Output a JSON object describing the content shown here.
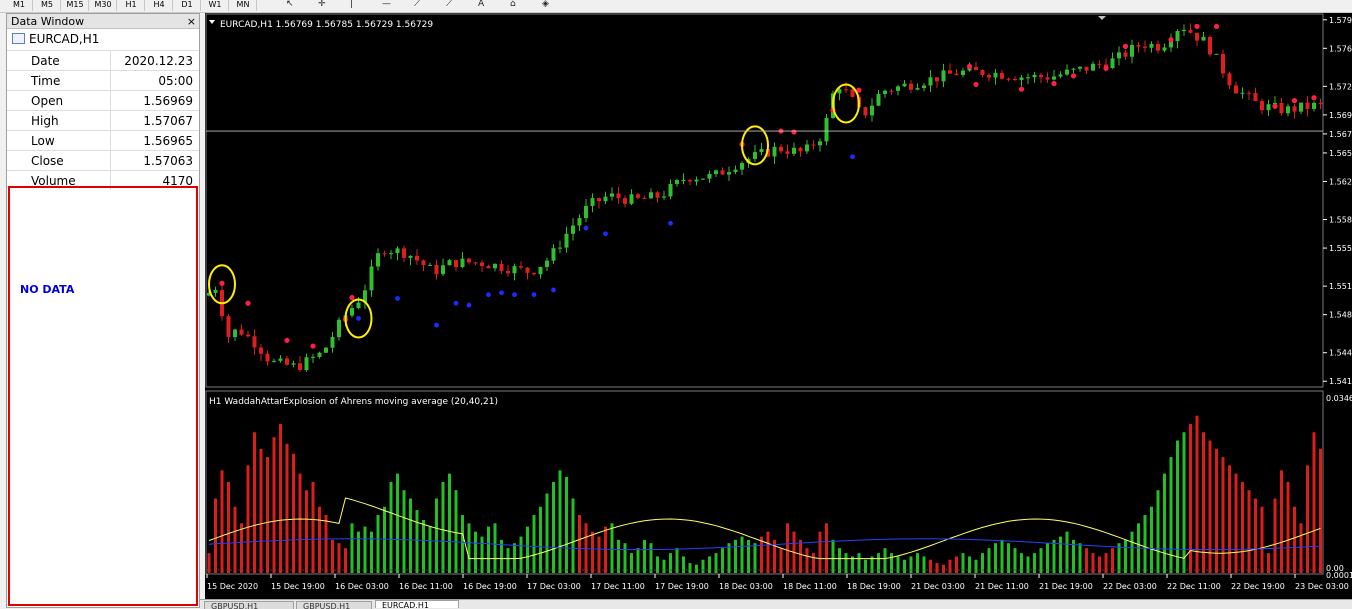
{
  "toolbar": {
    "timeframes": [
      "M1",
      "M5",
      "M15",
      "M30",
      "H1",
      "H4",
      "D1",
      "W1",
      "MN"
    ],
    "tool_icons": [
      "cursor-icon",
      "crosshair-icon",
      "vertical-line-icon",
      "horizontal-line-icon",
      "fibonacci-icon",
      "fibonacci-fan-icon",
      "text-icon",
      "label-icon",
      "shapes-dropdown-icon"
    ]
  },
  "data_window": {
    "title": "Data Window",
    "close": "×",
    "symbol": "EURCAD,H1",
    "rows": [
      {
        "label": "Date",
        "value": "2020.12.23"
      },
      {
        "label": "Time",
        "value": "05:00"
      },
      {
        "label": "Open",
        "value": "1.56969"
      },
      {
        "label": "High",
        "value": "1.57067"
      },
      {
        "label": "Low",
        "value": "1.56965"
      },
      {
        "label": "Close",
        "value": "1.57063"
      },
      {
        "label": "Volume",
        "value": "4170"
      }
    ],
    "empty_text": "NO DATA"
  },
  "chart_data": [
    {
      "type": "candlestick",
      "header": "EURCAD,H1  1.56769 1.56785 1.56729 1.56729",
      "current_price": 1.5673,
      "y_ticks": [
        "1.579",
        "1.576",
        "1.572",
        "1.569",
        "1.567",
        "1.565",
        "1.562",
        "1.558",
        "1.555",
        "1.551",
        "1.548",
        "1.544",
        "1.541"
      ],
      "ylim": [
        1.5405,
        1.5795
      ],
      "bull_color": "#2fbf2f",
      "bear_color": "#e01e1e",
      "markers_red": [
        [
          2,
          1.5513
        ],
        [
          6,
          1.5492
        ],
        [
          12,
          1.5453
        ],
        [
          16,
          1.5447
        ],
        [
          21,
          1.5475
        ],
        [
          22,
          1.5498
        ],
        [
          82,
          1.5659
        ],
        [
          88,
          1.5673
        ],
        [
          90,
          1.5672
        ],
        [
          96,
          1.5695
        ],
        [
          100,
          1.5716
        ],
        [
          117,
          1.5741
        ],
        [
          118,
          1.5722
        ],
        [
          125,
          1.5717
        ],
        [
          130,
          1.5723
        ],
        [
          133,
          1.5731
        ],
        [
          138,
          1.5739
        ],
        [
          141,
          1.5762
        ],
        [
          148,
          1.5769
        ],
        [
          152,
          1.5783
        ],
        [
          155,
          1.5783
        ],
        [
          164,
          1.5699
        ],
        [
          167,
          1.5705
        ],
        [
          170,
          1.5708
        ]
      ],
      "markers_blue": [
        [
          23,
          1.5476
        ],
        [
          29,
          1.5497
        ],
        [
          35,
          1.5469
        ],
        [
          38,
          1.5492
        ],
        [
          40,
          1.549
        ],
        [
          43,
          1.5501
        ],
        [
          45,
          1.5503
        ],
        [
          47,
          1.5501
        ],
        [
          50,
          1.5501
        ],
        [
          53,
          1.5506
        ],
        [
          58,
          1.5571
        ],
        [
          61,
          1.5565
        ],
        [
          71,
          1.5576
        ],
        [
          99,
          1.5646
        ]
      ],
      "circles": [
        [
          2,
          1.5512
        ],
        [
          23,
          1.5476
        ],
        [
          84,
          1.5658
        ],
        [
          98,
          1.5702
        ]
      ]
    },
    {
      "type": "bar",
      "title": "H1 WaddahAttarExplosion of Ahrens moving average (20,40,21)",
      "y_ticks": [
        "0.0346",
        "0.00",
        "0.0001"
      ],
      "x_ticks": [
        "15 Dec 2020",
        "15 Dec 19:00",
        "16 Dec 03:00",
        "16 Dec 11:00",
        "16 Dec 19:00",
        "17 Dec 03:00",
        "17 Dec 11:00",
        "17 Dec 19:00",
        "18 Dec 03:00",
        "18 Dec 11:00",
        "18 Dec 19:00",
        "21 Dec 03:00",
        "21 Dec 11:00",
        "21 Dec 19:00",
        "22 Dec 03:00",
        "22 Dec 11:00",
        "22 Dec 19:00",
        "23 Dec 03:00"
      ],
      "series": [
        {
          "color": "#22c022",
          "kind": "bars"
        },
        {
          "color": "#dd1c1c",
          "kind": "bars"
        },
        {
          "color": "#ffff66",
          "kind": "line"
        },
        {
          "color": "#2244ff",
          "kind": "line"
        }
      ]
    }
  ]
}
